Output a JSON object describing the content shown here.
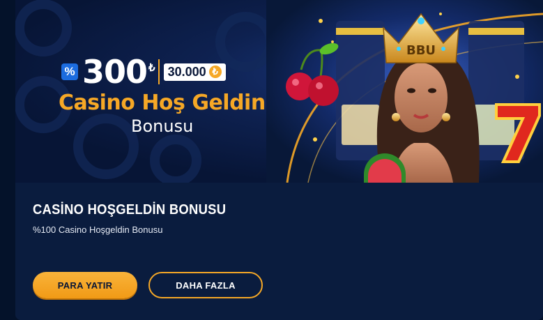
{
  "banner": {
    "percent_icon": "%",
    "big_number": "300",
    "lira_symbol": "₺",
    "amount": "30.000",
    "amount_currency": "₺",
    "title": "Casino Hoş Geldin",
    "subtitle": "Bonusu",
    "crown_text": "BBU"
  },
  "bonus": {
    "title": "CASİNO HOŞGELDİN BONUSU",
    "description": "%100 Casino Hoşgeldin Bonusu"
  },
  "buttons": {
    "deposit": "PARA YATIR",
    "more": "DAHA FAZLA"
  },
  "colors": {
    "accent": "#f6a826",
    "background": "#0a1c3e",
    "badge_blue": "#1c6cdf"
  }
}
